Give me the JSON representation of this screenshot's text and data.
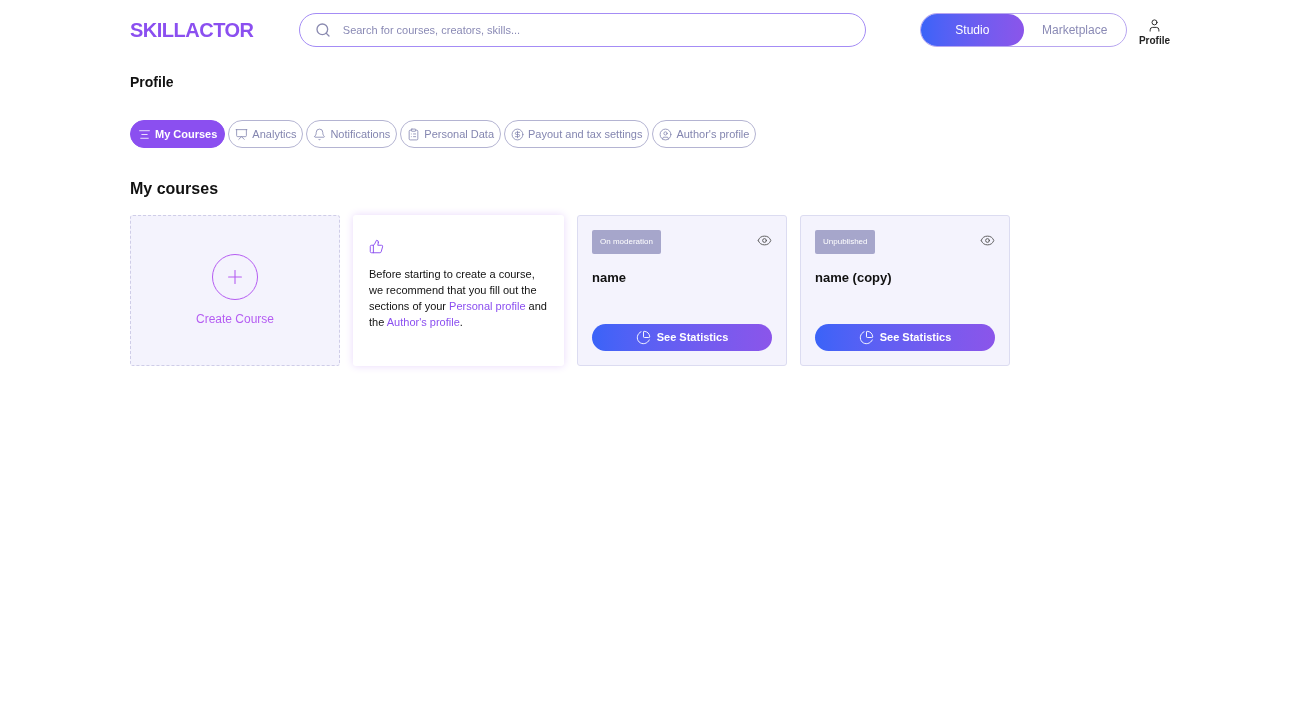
{
  "header": {
    "logo": "SKILLACTOR",
    "search": {
      "placeholder": "Search for courses, creators, skills..."
    },
    "modes": [
      {
        "label": "Studio",
        "selected": true
      },
      {
        "label": "Marketplace",
        "selected": false
      }
    ],
    "profile": "Profile"
  },
  "page_title": "Profile",
  "tabs": [
    {
      "label": "My Courses",
      "kind": "list",
      "selected": true
    },
    {
      "label": "Analytics",
      "kind": "chart",
      "selected": false
    },
    {
      "label": "Notifications",
      "kind": "bell",
      "selected": false
    },
    {
      "label": "Personal Data",
      "kind": "clipboard",
      "selected": false
    },
    {
      "label": "Payout and tax settings",
      "kind": "dollar",
      "selected": false
    },
    {
      "label": "Author's profile",
      "kind": "user",
      "selected": false
    }
  ],
  "section_title": "My courses",
  "create_card": {
    "label": "Create Course"
  },
  "tip": {
    "before": "Before starting to create a course, we recommend that you fill out the sections of your",
    "link1": "Personal profile",
    "middle": "and the",
    "link2": "Author's profile",
    "after": "."
  },
  "courses": [
    {
      "status": "On moderation",
      "name": "name",
      "button": "See Statistics"
    },
    {
      "status": "Unpublished",
      "name": "name (copy)",
      "button": "See Statistics"
    }
  ]
}
